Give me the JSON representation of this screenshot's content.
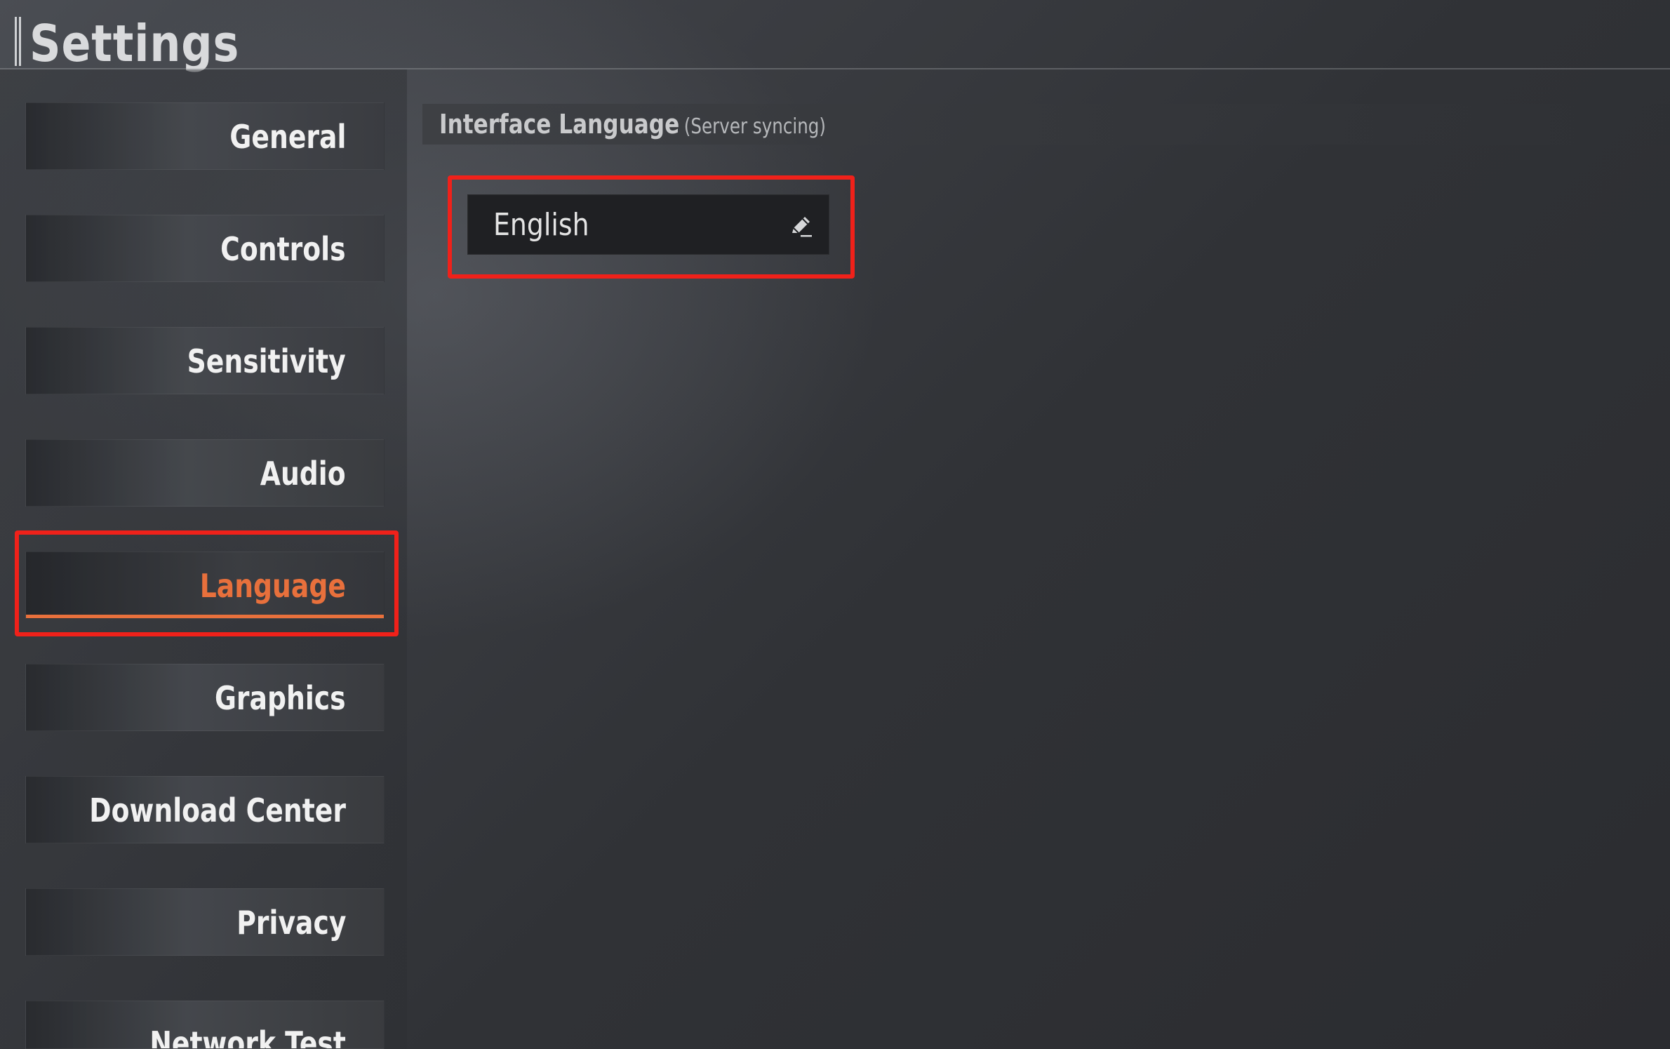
{
  "header": {
    "title": "Settings"
  },
  "sidebar": {
    "items": [
      {
        "label": "General",
        "active": false
      },
      {
        "label": "Controls",
        "active": false
      },
      {
        "label": "Sensitivity",
        "active": false
      },
      {
        "label": "Audio",
        "active": false
      },
      {
        "label": "Language",
        "active": true
      },
      {
        "label": "Graphics",
        "active": false
      },
      {
        "label": "Download Center",
        "active": false
      },
      {
        "label": "Privacy",
        "active": false
      },
      {
        "label": "Network Test",
        "active": false
      }
    ]
  },
  "content": {
    "section_title": "Interface Language",
    "section_subtitle": "(Server syncing)",
    "language_value": "English",
    "edit_icon": "pencil-icon"
  },
  "colors": {
    "accent": "#e8703c",
    "highlight": "#f0211a"
  }
}
